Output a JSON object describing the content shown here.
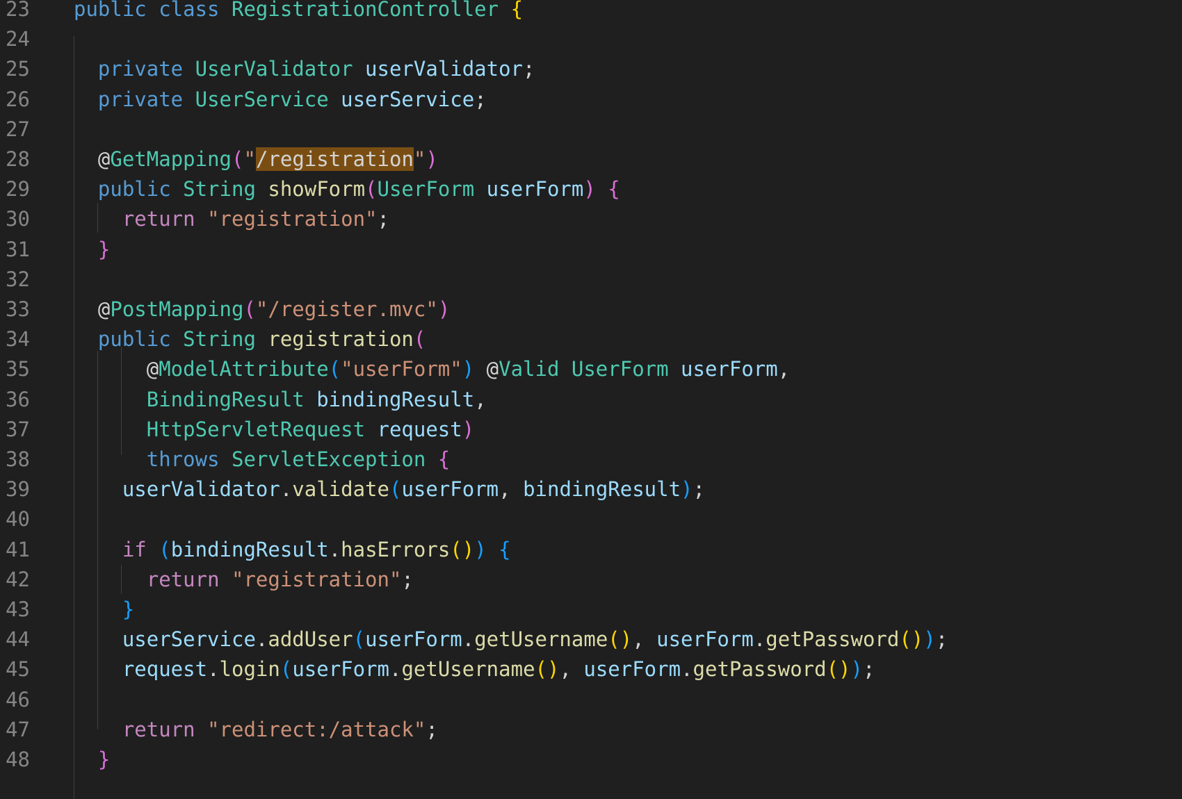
{
  "editor": {
    "line_numbers": [
      "23",
      "24",
      "25",
      "26",
      "27",
      "28",
      "29",
      "30",
      "31",
      "32",
      "33",
      "34",
      "35",
      "36",
      "37",
      "38",
      "39",
      "40",
      "41",
      "42",
      "43",
      "44",
      "45",
      "46",
      "47",
      "48"
    ],
    "search_highlight": "/registration",
    "lines": [
      [
        [
          "kw",
          "public "
        ],
        [
          "kw",
          "class "
        ],
        [
          "ty",
          "RegistrationController "
        ],
        [
          "p1",
          "{"
        ]
      ],
      [],
      [
        [
          "pl",
          "  "
        ],
        [
          "kw",
          "private "
        ],
        [
          "ty",
          "UserValidator "
        ],
        [
          "var",
          "userValidator"
        ],
        [
          "pl",
          ";"
        ]
      ],
      [
        [
          "pl",
          "  "
        ],
        [
          "kw",
          "private "
        ],
        [
          "ty",
          "UserService "
        ],
        [
          "var",
          "userService"
        ],
        [
          "pl",
          ";"
        ]
      ],
      [],
      [
        [
          "pl",
          "  @"
        ],
        [
          "ty",
          "GetMapping"
        ],
        [
          "p2",
          "("
        ],
        [
          "str",
          "\""
        ],
        [
          "hl",
          "/registration"
        ],
        [
          "str",
          "\""
        ],
        [
          "p2",
          ")"
        ]
      ],
      [
        [
          "pl",
          "  "
        ],
        [
          "kw",
          "public "
        ],
        [
          "ty",
          "String "
        ],
        [
          "fn",
          "showForm"
        ],
        [
          "p2",
          "("
        ],
        [
          "ty",
          "UserForm "
        ],
        [
          "var",
          "userForm"
        ],
        [
          "p2",
          ")"
        ],
        [
          "pl",
          " "
        ],
        [
          "p2",
          "{"
        ]
      ],
      [
        [
          "pl",
          "    "
        ],
        [
          "ctrl",
          "return "
        ],
        [
          "str",
          "\"registration\""
        ],
        [
          "pl",
          ";"
        ]
      ],
      [
        [
          "pl",
          "  "
        ],
        [
          "p2",
          "}"
        ]
      ],
      [],
      [
        [
          "pl",
          "  @"
        ],
        [
          "ty",
          "PostMapping"
        ],
        [
          "p2",
          "("
        ],
        [
          "str",
          "\"/register.mvc\""
        ],
        [
          "p2",
          ")"
        ]
      ],
      [
        [
          "pl",
          "  "
        ],
        [
          "kw",
          "public "
        ],
        [
          "ty",
          "String "
        ],
        [
          "fn",
          "registration"
        ],
        [
          "p2",
          "("
        ]
      ],
      [
        [
          "pl",
          "      @"
        ],
        [
          "ty",
          "ModelAttribute"
        ],
        [
          "p3",
          "("
        ],
        [
          "str",
          "\"userForm\""
        ],
        [
          "p3",
          ")"
        ],
        [
          "pl",
          " @"
        ],
        [
          "ty",
          "Valid "
        ],
        [
          "ty",
          "UserForm "
        ],
        [
          "var",
          "userForm"
        ],
        [
          "pl",
          ","
        ]
      ],
      [
        [
          "pl",
          "      "
        ],
        [
          "ty",
          "BindingResult "
        ],
        [
          "var",
          "bindingResult"
        ],
        [
          "pl",
          ","
        ]
      ],
      [
        [
          "pl",
          "      "
        ],
        [
          "ty",
          "HttpServletRequest "
        ],
        [
          "var",
          "request"
        ],
        [
          "p2",
          ")"
        ]
      ],
      [
        [
          "pl",
          "      "
        ],
        [
          "kw",
          "throws "
        ],
        [
          "ty",
          "ServletException "
        ],
        [
          "p2",
          "{"
        ]
      ],
      [
        [
          "pl",
          "    "
        ],
        [
          "var",
          "userValidator"
        ],
        [
          "pl",
          "."
        ],
        [
          "fn",
          "validate"
        ],
        [
          "p3",
          "("
        ],
        [
          "var",
          "userForm"
        ],
        [
          "pl",
          ", "
        ],
        [
          "var",
          "bindingResult"
        ],
        [
          "p3",
          ")"
        ],
        [
          "pl",
          ";"
        ]
      ],
      [],
      [
        [
          "pl",
          "    "
        ],
        [
          "ctrl",
          "if "
        ],
        [
          "p3",
          "("
        ],
        [
          "var",
          "bindingResult"
        ],
        [
          "pl",
          "."
        ],
        [
          "fn",
          "hasErrors"
        ],
        [
          "p1",
          "()"
        ],
        [
          "p3",
          ")"
        ],
        [
          "pl",
          " "
        ],
        [
          "p3",
          "{"
        ]
      ],
      [
        [
          "pl",
          "      "
        ],
        [
          "ctrl",
          "return "
        ],
        [
          "str",
          "\"registration\""
        ],
        [
          "pl",
          ";"
        ]
      ],
      [
        [
          "pl",
          "    "
        ],
        [
          "p3",
          "}"
        ]
      ],
      [
        [
          "pl",
          "    "
        ],
        [
          "var",
          "userService"
        ],
        [
          "pl",
          "."
        ],
        [
          "fn",
          "addUser"
        ],
        [
          "p3",
          "("
        ],
        [
          "var",
          "userForm"
        ],
        [
          "pl",
          "."
        ],
        [
          "fn",
          "getUsername"
        ],
        [
          "p1",
          "()"
        ],
        [
          "pl",
          ", "
        ],
        [
          "var",
          "userForm"
        ],
        [
          "pl",
          "."
        ],
        [
          "fn",
          "getPassword"
        ],
        [
          "p1",
          "()"
        ],
        [
          "p3",
          ")"
        ],
        [
          "pl",
          ";"
        ]
      ],
      [
        [
          "pl",
          "    "
        ],
        [
          "var",
          "request"
        ],
        [
          "pl",
          "."
        ],
        [
          "fn",
          "login"
        ],
        [
          "p3",
          "("
        ],
        [
          "var",
          "userForm"
        ],
        [
          "pl",
          "."
        ],
        [
          "fn",
          "getUsername"
        ],
        [
          "p1",
          "()"
        ],
        [
          "pl",
          ", "
        ],
        [
          "var",
          "userForm"
        ],
        [
          "pl",
          "."
        ],
        [
          "fn",
          "getPassword"
        ],
        [
          "p1",
          "()"
        ],
        [
          "p3",
          ")"
        ],
        [
          "pl",
          ";"
        ]
      ],
      [],
      [
        [
          "pl",
          "    "
        ],
        [
          "ctrl",
          "return "
        ],
        [
          "str",
          "\"redirect:/attack\""
        ],
        [
          "pl",
          ";"
        ]
      ],
      [
        [
          "pl",
          "  "
        ],
        [
          "p2",
          "}"
        ]
      ]
    ]
  }
}
